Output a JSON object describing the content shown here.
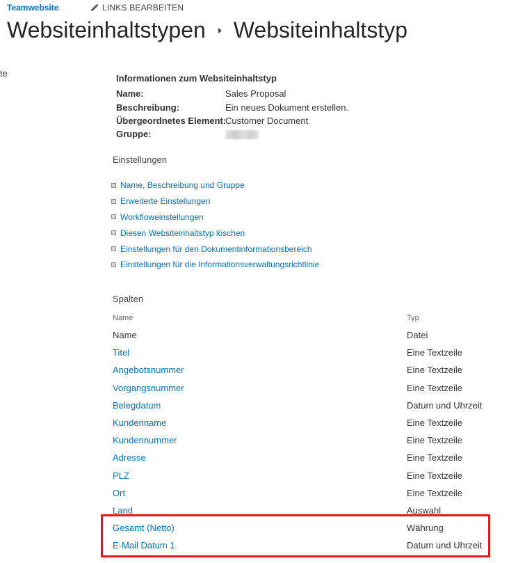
{
  "header": {
    "site_name": "Teamwebsite",
    "edit_links_label": "LINKS BEARBEITEN",
    "edit_icon": "pencil-icon"
  },
  "page_title": {
    "parent": "Websiteinhaltstypen",
    "current": "Websiteinhaltstyp",
    "separator_icon": "triangle-right-icon"
  },
  "left_nav_fragment": "te",
  "info": {
    "heading": "Informationen zum Websiteinhaltstyp",
    "rows": [
      {
        "label": "Name:",
        "value": "Sales Proposal"
      },
      {
        "label": "Beschreibung:",
        "value": "Ein neues Dokument erstellen."
      },
      {
        "label": "Übergeordnetes Element:",
        "value": "Customer Document"
      },
      {
        "label": "Gruppe:",
        "value": ""
      }
    ]
  },
  "settings": {
    "title": "Einstellungen",
    "links": [
      "Name, Beschreibung und Gruppe",
      "Erweiterte Einstellungen",
      "Workfloweinstellungen",
      "Diesen Websiteinhaltstyp löschen",
      "Einstellungen für den Dokumentinformationsbereich",
      "Einstellungen für die Informationsverwaltungsrichtlinie"
    ]
  },
  "columns": {
    "title": "Spalten",
    "header_name": "Name",
    "header_type": "Typ",
    "rows": [
      {
        "name": "Name",
        "type": "Datei"
      },
      {
        "name": "Titel",
        "type": "Eine Textzeile"
      },
      {
        "name": "Angebotsnummer",
        "type": "Eine Textzeile"
      },
      {
        "name": "Vorgangsnummer",
        "type": "Eine Textzeile"
      },
      {
        "name": "Belegdatum",
        "type": "Datum und Uhrzeit"
      },
      {
        "name": "Kundenname",
        "type": "Eine Textzeile"
      },
      {
        "name": "Kundennummer",
        "type": "Eine Textzeile"
      },
      {
        "name": "Adresse",
        "type": "Eine Textzeile"
      },
      {
        "name": "PLZ",
        "type": "Eine Textzeile"
      },
      {
        "name": "Ort",
        "type": "Eine Textzeile"
      },
      {
        "name": "Land",
        "type": "Auswahl"
      },
      {
        "name": "Gesamt (Netto)",
        "type": "Währung"
      },
      {
        "name": "E-Mail Datum 1",
        "type": "Datum und Uhrzeit"
      }
    ]
  },
  "colors": {
    "link": "#0072c6",
    "highlight": "#e8151c",
    "text": "#333333"
  }
}
